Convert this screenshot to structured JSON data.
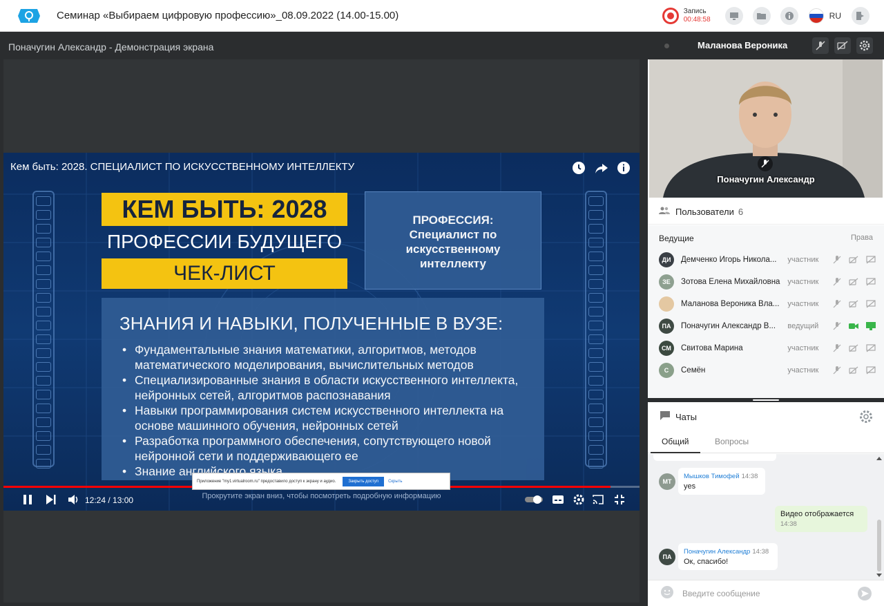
{
  "header": {
    "title": "Семинар «Выбираем цифровую профессию»_08.09.2022 (14.00-15.00)",
    "record_label": "Запись",
    "record_time": "00:48:58",
    "lang": "RU"
  },
  "share": {
    "title": "Поначугин Александр - Демонстрация экрана",
    "video_title": "Кем быть: 2028. СПЕЦИАЛИСТ ПО ИСКУССТВЕННОМУ ИНТЕЛЛЕКТУ",
    "slide": {
      "line1": "КЕМ БЫТЬ: 2028",
      "line2": "ПРОФЕССИИ БУДУЩЕГО",
      "line3": "ЧЕК-ЛИСТ",
      "profession": "ПРОФЕССИЯ:\nСпециалист по\nискусственному\nинтеллекту",
      "knowledge_heading": "ЗНАНИЯ И НАВЫКИ, ПОЛУЧЕННЫЕ В ВУЗЕ:",
      "bullets": [
        "Фундаментальные знания математики, алгоритмов, методов математического моделирования, вычислительных методов",
        "Специализированные знания в области искусственного интеллекта, нейронных сетей, алгоритмов распознавания",
        "Навыки программирования систем искусственного интеллекта на основе машинного обучения, нейронных сетей",
        "Разработка программного обеспечения, сопутствующего новой нейронной сети и поддерживающего ее",
        "Знание английского языка"
      ]
    },
    "notice": {
      "text": "Приложение \"my1.virtualroom.ru\" предоставило доступ к экрану и аудио.",
      "stop_label": "Закрыть доступ",
      "hide_label": "Скрыть"
    },
    "scroll_hint": "Прокрутите экран вниз, чтобы посмотреть подробную информацию",
    "time": "12:24 / 13:00",
    "progress": 0.954
  },
  "camera": {
    "header_name": "Маланова Вероника",
    "label": "Поначугин Александр"
  },
  "users": {
    "label": "Пользователи",
    "count": "6",
    "leads_label": "Ведущие",
    "rights_label": "Права",
    "items": [
      {
        "initials": "ДИ",
        "name": "Демченко Игорь Никола...",
        "role": "участник",
        "color": "#3a3f45"
      },
      {
        "initials": "ЗЕ",
        "name": "Зотова Елена Михайловна",
        "role": "участник",
        "color": "#8ea090"
      },
      {
        "initials": "",
        "name": "Маланова Вероника Вла...",
        "role": "участник",
        "color": "#e4c8a2"
      },
      {
        "initials": "ПА",
        "name": "Поначугин Александр В...",
        "role": "ведущий",
        "color": "#3f4a44"
      },
      {
        "initials": "СМ",
        "name": "Свитова Марина",
        "role": "участник",
        "color": "#3c4a40"
      },
      {
        "initials": "С",
        "name": "Семён",
        "role": "участник",
        "color": "#8aa08a"
      }
    ]
  },
  "chats": {
    "label": "Чаты",
    "tabs": [
      "Общий",
      "Вопросы"
    ],
    "messages": [
      {
        "initials": "МТ",
        "author": "Мышков Тимофей",
        "time": "14:38",
        "text": "yes"
      },
      {
        "initials": "",
        "author": "",
        "time": "14:38",
        "text": "Видео отображается"
      },
      {
        "initials": "ПА",
        "author": "Поначугин Александр",
        "time": "14:38",
        "text": "Ок, спасибо!"
      }
    ],
    "input_placeholder": "Введите сообщение"
  }
}
